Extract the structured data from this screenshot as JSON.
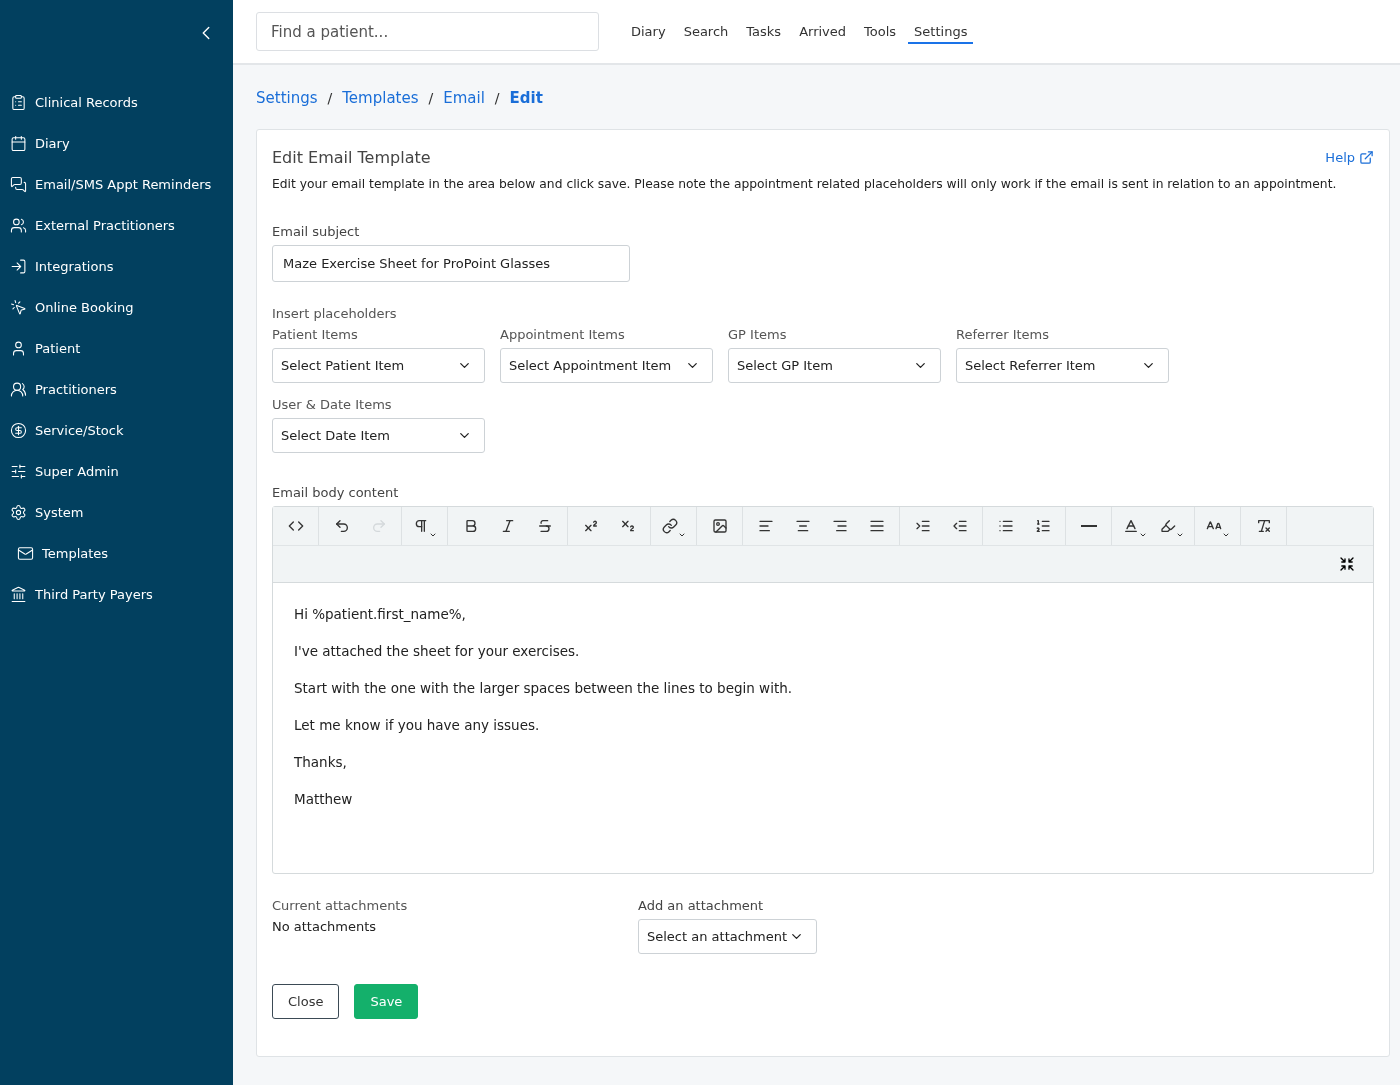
{
  "sidebar": {
    "items": [
      {
        "label": "Clinical Records",
        "kind": "records"
      },
      {
        "label": "Diary",
        "kind": "calendar"
      },
      {
        "label": "Email/SMS Appt Reminders",
        "kind": "chat"
      },
      {
        "label": "External Practitioners",
        "kind": "group"
      },
      {
        "label": "Integrations",
        "kind": "login"
      },
      {
        "label": "Online Booking",
        "kind": "click"
      },
      {
        "label": "Patient",
        "kind": "person"
      },
      {
        "label": "Practitioners",
        "kind": "people"
      },
      {
        "label": "Service/Stock",
        "kind": "dollar"
      },
      {
        "label": "Super Admin",
        "kind": "sliders"
      },
      {
        "label": "System",
        "kind": "gear",
        "children": [
          {
            "label": "Templates",
            "kind": "mail"
          }
        ]
      },
      {
        "label": "Third Party Payers",
        "kind": "bank"
      }
    ]
  },
  "header": {
    "search": {
      "placeholder": "Find a patient..."
    },
    "nav": [
      {
        "label": "Diary",
        "selected": false
      },
      {
        "label": "Search",
        "selected": false
      },
      {
        "label": "Tasks",
        "selected": false
      },
      {
        "label": "Arrived",
        "selected": false
      },
      {
        "label": "Tools",
        "selected": false
      },
      {
        "label": "Settings",
        "selected": true
      }
    ]
  },
  "breadcrumb": [
    {
      "label": "Settings",
      "current": false
    },
    {
      "separator": "/",
      "label": "Templates",
      "current": false
    },
    {
      "separator": "/",
      "label": "Email",
      "current": false
    },
    {
      "separator": "/",
      "label": "Edit",
      "current": true
    }
  ],
  "card": {
    "title": "Edit Email Template",
    "help": "Help",
    "description": "Edit your email template in the area below and click save. Please note the appointment related placeholders will only work if the email is sent in relation to an appointment.",
    "subject": {
      "label": "Email subject",
      "value": "Maze Exercise Sheet for ProPoint Glasses"
    },
    "placeholders": {
      "label": "Insert placeholders",
      "selects": [
        {
          "label": "Patient Items",
          "value": "Select Patient Item"
        },
        {
          "label": "Appointment Items",
          "value": "Select Appointment Item"
        },
        {
          "label": "GP Items",
          "value": "Select GP Item"
        },
        {
          "label": "Referrer Items",
          "value": "Select Referrer Item"
        },
        {
          "label": "User & Date Items",
          "value": "Select Date Item"
        }
      ]
    },
    "body": {
      "label": "Email body content",
      "toolbar": [
        [
          {
            "kind": "code",
            "disabled": false
          }
        ],
        [
          {
            "kind": "undo",
            "disabled": false
          },
          {
            "kind": "redo",
            "disabled": true
          }
        ],
        [
          {
            "kind": "paragraph",
            "disabled": false
          }
        ],
        [
          {
            "kind": "bold",
            "disabled": false
          },
          {
            "kind": "italic",
            "disabled": false
          },
          {
            "kind": "strike",
            "disabled": false
          }
        ],
        [
          {
            "kind": "superscript",
            "disabled": false
          },
          {
            "kind": "subscript",
            "disabled": false
          }
        ],
        [
          {
            "kind": "link",
            "disabled": false
          }
        ],
        [
          {
            "kind": "image",
            "disabled": false
          }
        ],
        [
          {
            "kind": "align-left",
            "disabled": false
          },
          {
            "kind": "align-center",
            "disabled": false
          },
          {
            "kind": "align-right",
            "disabled": false
          },
          {
            "kind": "justify",
            "disabled": false
          }
        ],
        [
          {
            "kind": "indent",
            "disabled": false
          },
          {
            "kind": "outdent",
            "disabled": false
          }
        ],
        [
          {
            "kind": "bullets",
            "disabled": false
          },
          {
            "kind": "numbers",
            "disabled": false
          }
        ],
        [
          {
            "kind": "rule",
            "disabled": false
          }
        ],
        [
          {
            "kind": "font-color",
            "disabled": false
          },
          {
            "kind": "highlight",
            "disabled": false
          }
        ],
        [
          {
            "kind": "font-size",
            "disabled": false
          }
        ],
        [
          {
            "kind": "clear",
            "disabled": false
          }
        ]
      ],
      "paragraphs": [
        "Hi %patient.first_name%,",
        "I've attached the sheet for your exercises.",
        "Start with the one with the larger spaces between the lines to begin with.",
        "Let me know if you have any issues.",
        "Thanks,",
        "Matthew"
      ]
    },
    "attachments": {
      "label": "Current attachments",
      "value": "No attachments",
      "add_label": "Add an attachment",
      "add_value": "Select an attachment"
    },
    "buttons": [
      {
        "label": "Close",
        "kind": "secondary"
      },
      {
        "label": "Save",
        "kind": "primary"
      }
    ]
  }
}
